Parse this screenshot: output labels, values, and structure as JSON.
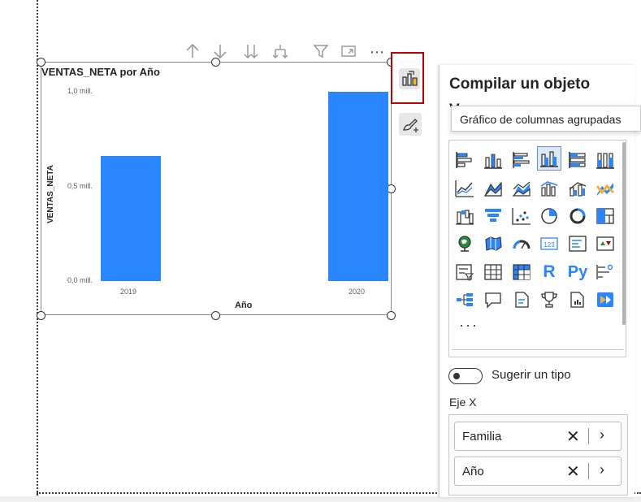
{
  "visual_header": {
    "icons": [
      "arrow-up-icon",
      "arrow-down-icon",
      "double-arrow-down-icon",
      "fork-down-icon",
      "filter-icon",
      "focus-mode-icon",
      "more-options-icon"
    ],
    "more_label": "⋯"
  },
  "chart": {
    "title": "VENTAS_NETA por Año",
    "y_ticks": [
      "1,0 mill.",
      "0,5 mill.",
      "0,0 mill."
    ],
    "ylabel": "VENTAS_NETA",
    "xlabel": "Año",
    "x_ticks": [
      "2019",
      "2020"
    ],
    "bar_color": "#2a86ff"
  },
  "chart_data": {
    "type": "bar",
    "title": "VENTAS_NETA por Año",
    "xlabel": "Año",
    "ylabel": "VENTAS_NETA",
    "categories": [
      "2019",
      "2020"
    ],
    "values": [
      0.66,
      1.0
    ],
    "units": "mill.",
    "ylim": [
      0,
      1.0
    ],
    "grid": false
  },
  "side_buttons": {
    "build_visual": "build-visual-icon",
    "format_visual": "format-visual-icon",
    "highlight_color": "#c00000"
  },
  "pane": {
    "title": "Compilar un objeto",
    "subtitle": "V",
    "tooltip": "Gráfico de columnas agrupadas",
    "more_label": "···",
    "suggest_label": "Sugerir un tipo",
    "axis_label": "Eje X",
    "fields": [
      {
        "label": "Familia",
        "remove": "✕",
        "chevron": "›"
      },
      {
        "label": "Año",
        "remove": "✕",
        "chevron": "›"
      }
    ]
  }
}
